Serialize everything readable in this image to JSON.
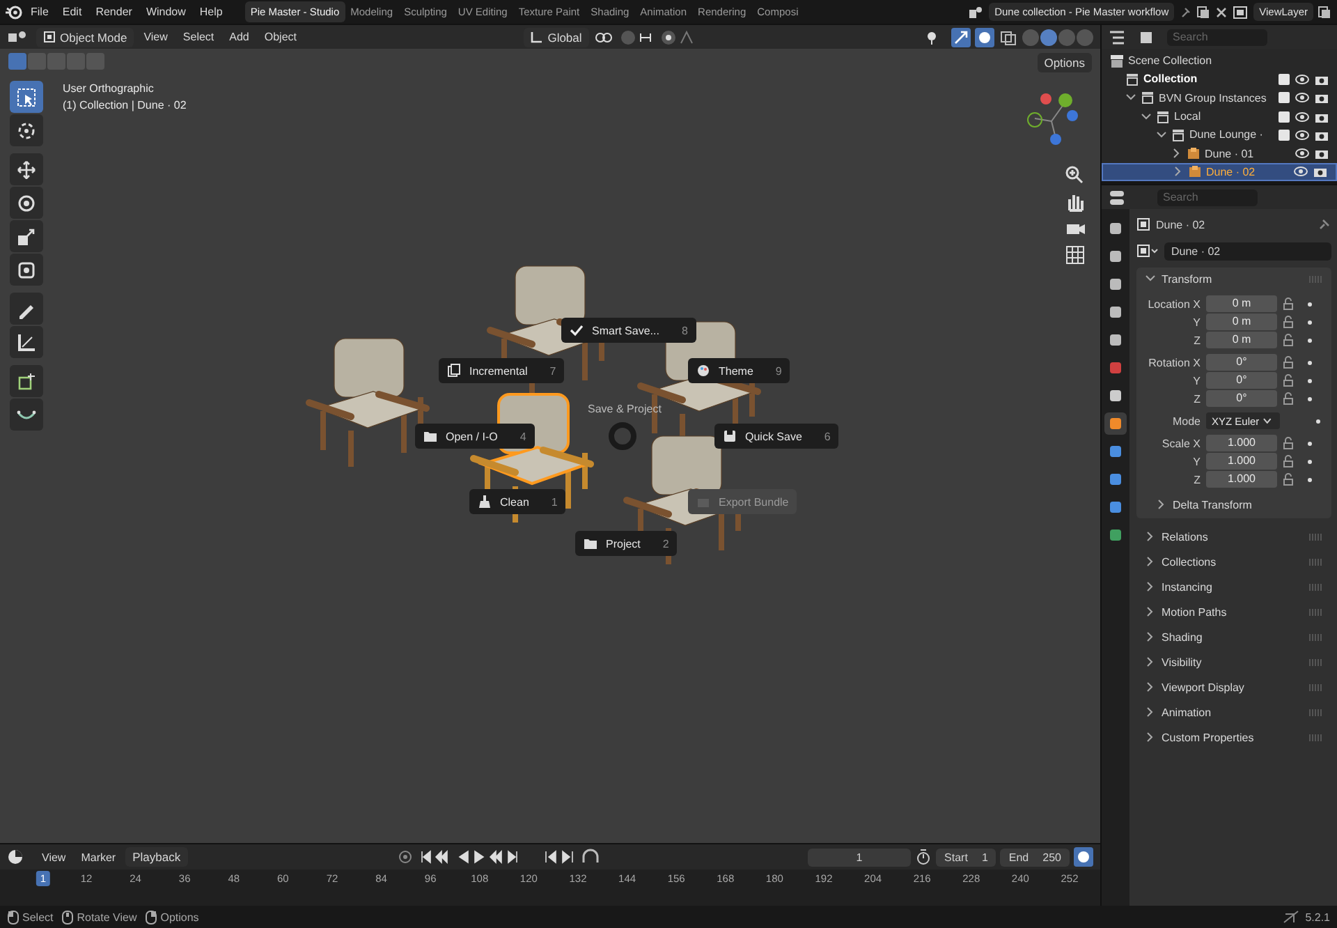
{
  "top_bar": {
    "menus": [
      "File",
      "Edit",
      "Render",
      "Window",
      "Help"
    ],
    "workspaces": [
      {
        "label": "Pie Master - Studio",
        "selected": true
      },
      {
        "label": "Modeling",
        "selected": false
      },
      {
        "label": "Sculpting",
        "selected": false
      },
      {
        "label": "UV Editing",
        "selected": false
      },
      {
        "label": "Texture Paint",
        "selected": false
      },
      {
        "label": "Shading",
        "selected": false
      },
      {
        "label": "Animation",
        "selected": false
      },
      {
        "label": "Rendering",
        "selected": false
      },
      {
        "label": "Composi",
        "selected": false
      }
    ],
    "scene": "Dune collection - Pie Master workflow",
    "view_layer": "ViewLayer"
  },
  "viewport_header": {
    "mode": "Object Mode",
    "menus": [
      "View",
      "Select",
      "Add",
      "Object"
    ],
    "orientation": "Global",
    "shading_modes": [
      {
        "selected": false
      },
      {
        "selected": true
      },
      {
        "selected": false
      },
      {
        "selected": false
      }
    ]
  },
  "viewport": {
    "options_button": "Options",
    "view_name": "User Orthographic",
    "collection_label": "(1) Collection | Dune · 02",
    "select_modes": [
      {
        "selected": true
      },
      {
        "selected": false
      },
      {
        "selected": false
      },
      {
        "selected": false
      },
      {
        "selected": false
      }
    ],
    "tools": [
      {
        "kind": "select",
        "selected": true
      },
      {
        "kind": "cursor",
        "selected": false
      },
      {
        "kind": "move",
        "selected": false
      },
      {
        "kind": "rotate",
        "selected": false
      },
      {
        "kind": "scale",
        "selected": false
      },
      {
        "kind": "transform",
        "selected": false
      },
      {
        "kind": "annotate",
        "selected": false
      },
      {
        "kind": "measure",
        "selected": false
      },
      {
        "kind": "add-cube",
        "selected": false
      },
      {
        "kind": "curve",
        "selected": false
      }
    ]
  },
  "pie_menu": {
    "title": "Save & Project",
    "items": [
      {
        "kind": "check",
        "label": "Smart Save...",
        "shortcut": "8",
        "disabled": false
      },
      {
        "kind": "pages",
        "label": "Incremental",
        "shortcut": "7",
        "disabled": false
      },
      {
        "kind": "palette",
        "label": "Theme",
        "shortcut": "9",
        "disabled": false
      },
      {
        "kind": "folder",
        "label": "Open / I-O",
        "shortcut": "4",
        "disabled": false
      },
      {
        "kind": "disk",
        "label": "Quick Save",
        "shortcut": "6",
        "disabled": false
      },
      {
        "kind": "brush",
        "label": "Clean",
        "shortcut": "1",
        "disabled": false
      },
      {
        "kind": "folder",
        "label": "Project",
        "shortcut": "2",
        "disabled": false
      },
      {
        "kind": "box",
        "label": "Export Bundle",
        "disabled": true
      }
    ]
  },
  "outliner": {
    "search": {
      "placeholder": "Search"
    },
    "tree": [
      {
        "label": "Scene Collection",
        "kind": "scene",
        "children": [
          {
            "label": "Collection",
            "kind": "collection",
            "active": true,
            "checked": true
          },
          {
            "label": "BVN Group Instances",
            "kind": "collection",
            "active": false,
            "checked": true,
            "expanded": true,
            "children": [
              {
                "label": "Local",
                "kind": "collection",
                "active": false,
                "checked": true,
                "expanded": true,
                "children": [
                  {
                    "label": "Dune Lounge ·",
                    "kind": "collection",
                    "active": false,
                    "checked": true,
                    "expanded": true,
                    "children": [
                      {
                        "label": "Dune · 01",
                        "kind": "object",
                        "selected": false,
                        "expanded": false
                      },
                      {
                        "label": "Dune · 02",
                        "kind": "object",
                        "selected": true,
                        "expanded": false
                      }
                    ]
                  }
                ]
              }
            ]
          }
        ]
      }
    ]
  },
  "properties": {
    "search": {
      "placeholder": "Search"
    },
    "tabs": [
      {
        "kind": "tool",
        "selected": false
      },
      {
        "kind": "render",
        "selected": false
      },
      {
        "kind": "output",
        "selected": false
      },
      {
        "kind": "view-layer",
        "selected": false
      },
      {
        "kind": "scene",
        "selected": false
      },
      {
        "kind": "world",
        "selected": false
      },
      {
        "kind": "collection",
        "selected": false
      },
      {
        "kind": "object",
        "selected": true
      },
      {
        "kind": "modifiers",
        "selected": false
      },
      {
        "kind": "particles",
        "selected": false
      },
      {
        "kind": "physics",
        "selected": false
      },
      {
        "kind": "constraints",
        "selected": false
      }
    ],
    "object_name": "Dune · 02",
    "data_name": "Dune · 02",
    "transform": {
      "title": "Transform",
      "expanded": true,
      "groups": [
        [
          {
            "label": "Location X",
            "value": "0 m",
            "kind": "number"
          },
          {
            "label": "Y",
            "value": "0 m",
            "kind": "number"
          },
          {
            "label": "Z",
            "value": "0 m",
            "kind": "number"
          }
        ],
        [
          {
            "label": "Rotation X",
            "value": "0°",
            "kind": "number"
          },
          {
            "label": "Y",
            "value": "0°",
            "kind": "number"
          },
          {
            "label": "Z",
            "value": "0°",
            "kind": "number"
          }
        ],
        [
          {
            "label": "Mode",
            "value": "XYZ Euler",
            "kind": "dropdown"
          }
        ],
        [
          {
            "label": "Scale X",
            "value": "1.000",
            "kind": "number"
          },
          {
            "label": "Y",
            "value": "1.000",
            "kind": "number"
          },
          {
            "label": "Z",
            "value": "1.000",
            "kind": "number"
          }
        ]
      ],
      "subpanel": {
        "title": "Delta Transform",
        "expanded": false
      }
    },
    "panels": [
      {
        "title": "Relations",
        "expanded": false
      },
      {
        "title": "Collections",
        "expanded": false
      },
      {
        "title": "Instancing",
        "expanded": false
      },
      {
        "title": "Motion Paths",
        "expanded": false
      },
      {
        "title": "Shading",
        "expanded": false
      },
      {
        "title": "Visibility",
        "expanded": false
      },
      {
        "title": "Viewport Display",
        "expanded": false
      },
      {
        "title": "Animation",
        "expanded": false
      },
      {
        "title": "Custom Properties",
        "expanded": false
      }
    ]
  },
  "timeline": {
    "menus": [
      "View",
      "Marker",
      "Playback"
    ],
    "current_frame": "1",
    "start_label": "Start",
    "start": "1",
    "end_label": "End",
    "end": "250",
    "ruler": [
      {
        "label": "1",
        "selected": true
      },
      {
        "label": "12",
        "selected": false
      },
      {
        "label": "24",
        "selected": false
      },
      {
        "label": "36",
        "selected": false
      },
      {
        "label": "48",
        "selected": false
      },
      {
        "label": "60",
        "selected": false
      },
      {
        "label": "72",
        "selected": false
      },
      {
        "label": "84",
        "selected": false
      },
      {
        "label": "96",
        "selected": false
      },
      {
        "label": "108",
        "selected": false
      },
      {
        "label": "120",
        "selected": false
      },
      {
        "label": "132",
        "selected": false
      },
      {
        "label": "144",
        "selected": false
      },
      {
        "label": "156",
        "selected": false
      },
      {
        "label": "168",
        "selected": false
      },
      {
        "label": "180",
        "selected": false
      },
      {
        "label": "192",
        "selected": false
      },
      {
        "label": "204",
        "selected": false
      },
      {
        "label": "216",
        "selected": false
      },
      {
        "label": "228",
        "selected": false
      },
      {
        "label": "240",
        "selected": false
      },
      {
        "label": "252",
        "selected": false
      }
    ]
  },
  "status_bar": {
    "hints": [
      {
        "kind": "mouse-left",
        "label": "Select"
      },
      {
        "kind": "mouse-middle",
        "label": "Rotate View"
      },
      {
        "kind": "mouse-right",
        "label": "Options"
      }
    ],
    "version": "5.2.1"
  }
}
